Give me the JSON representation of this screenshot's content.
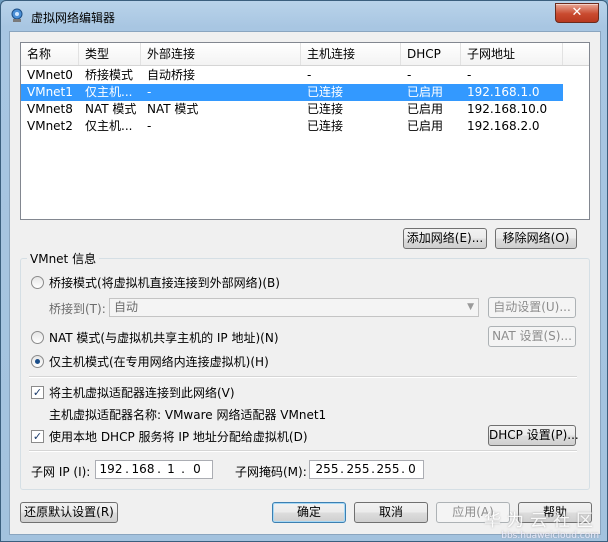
{
  "window": {
    "title": "虚拟网络编辑器",
    "close_glyph": "✕"
  },
  "list": {
    "columns": [
      "名称",
      "类型",
      "外部连接",
      "主机连接",
      "DHCP",
      "子网地址"
    ],
    "rows": [
      {
        "name": "VMnet0",
        "type": "桥接模式",
        "external": "自动桥接",
        "host": "-",
        "dhcp": "-",
        "subnet": "-",
        "selected": false
      },
      {
        "name": "VMnet1",
        "type": "仅主机...",
        "external": "-",
        "host": "已连接",
        "dhcp": "已启用",
        "subnet": "192.168.1.0",
        "selected": true
      },
      {
        "name": "VMnet8",
        "type": "NAT 模式",
        "external": "NAT 模式",
        "host": "已连接",
        "dhcp": "已启用",
        "subnet": "192.168.10.0",
        "selected": false
      },
      {
        "name": "VMnet2",
        "type": "仅主机...",
        "external": "-",
        "host": "已连接",
        "dhcp": "已启用",
        "subnet": "192.168.2.0",
        "selected": false
      }
    ]
  },
  "buttons": {
    "add_network": "添加网络(E)...",
    "remove_network": "移除网络(O)",
    "auto_settings": "自动设置(U)...",
    "nat_settings": "NAT 设置(S)...",
    "dhcp_settings": "DHCP 设置(P)...",
    "restore_defaults": "还原默认设置(R)",
    "ok": "确定",
    "cancel": "取消",
    "apply": "应用(A)",
    "help": "帮助"
  },
  "vmnet_info": {
    "group_title": "VMnet 信息",
    "bridged_label": "桥接模式(将虚拟机直接连接到外部网络)(B)",
    "bridged_to_label": "桥接到(T):",
    "bridged_to_value": "自动",
    "nat_label": "NAT 模式(与虚拟机共享主机的 IP 地址)(N)",
    "hostonly_label": "仅主机模式(在专用网络内连接虚拟机)(H)",
    "selected_mode": "hostonly",
    "connect_adapter_label": "将主机虚拟适配器连接到此网络(V)",
    "connect_adapter_checked": true,
    "adapter_name_text": "主机虚拟适配器名称: VMware 网络适配器 VMnet1",
    "use_dhcp_label": "使用本地 DHCP 服务将 IP 地址分配给虚拟机(D)",
    "use_dhcp_checked": true,
    "subnet_ip_label": "子网 IP (I):",
    "subnet_ip": [
      "192",
      "168",
      "1",
      "0"
    ],
    "subnet_mask_label": "子网掩码(M):",
    "subnet_mask": [
      "255",
      "255",
      "255",
      "0"
    ]
  },
  "watermark": {
    "brand": "华为云社区",
    "url": "bbs.huaweicloud.com"
  },
  "colors": {
    "selection": "#3399ff",
    "title_gradient": "#b9d3ea",
    "close_button": "#c94a2f"
  }
}
